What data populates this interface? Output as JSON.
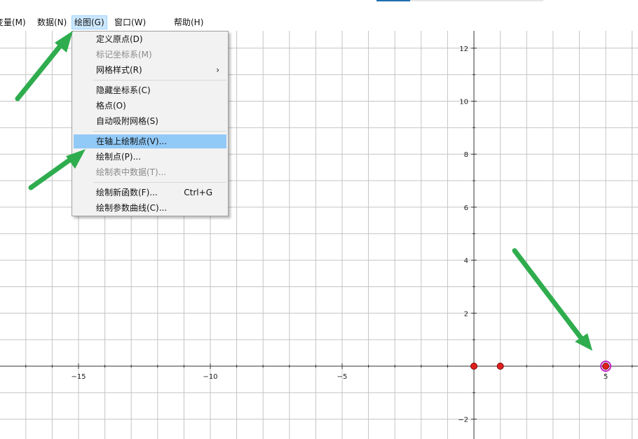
{
  "menubar": {
    "items": [
      {
        "label": "变量(M)"
      },
      {
        "label": "数据(N)"
      },
      {
        "label": "绘图(G)",
        "active": true
      },
      {
        "label": "窗口(W)"
      },
      {
        "label": "帮助(H)"
      }
    ]
  },
  "dropdown": {
    "items": [
      {
        "label": "定义原点(D)",
        "enabled": true
      },
      {
        "label": "标记坐标系(M)",
        "enabled": false
      },
      {
        "label": "网格样式(R)",
        "enabled": true,
        "submenu": true,
        "submenu_glyph": "›"
      },
      {
        "label": "隐藏坐标系(C)",
        "enabled": true
      },
      {
        "label": "格点(O)",
        "enabled": true
      },
      {
        "label": "自动吸附网格(S)",
        "enabled": true
      },
      {
        "label": "在轴上绘制点(V)...",
        "enabled": true,
        "highlighted": true
      },
      {
        "label": "绘制点(P)...",
        "enabled": true
      },
      {
        "label": "绘制表中数据(T)...",
        "enabled": false
      },
      {
        "label": "绘制新函数(F)...",
        "enabled": true,
        "shortcut": "Ctrl+G"
      },
      {
        "label": "绘制参数曲线(C)...",
        "enabled": true
      }
    ]
  },
  "graph": {
    "x_range": [
      -18,
      6
    ],
    "y_range": [
      -2.8,
      12.6
    ],
    "grid_step": 1,
    "x_tick_labels": [
      {
        "value": -15,
        "text": "−15"
      },
      {
        "value": -10,
        "text": "−10"
      },
      {
        "value": -5,
        "text": "−5"
      },
      {
        "value": 5,
        "text": "5"
      }
    ],
    "y_tick_labels": [
      {
        "value": 12,
        "text": "12"
      },
      {
        "value": 10,
        "text": "10"
      },
      {
        "value": 8,
        "text": "8"
      },
      {
        "value": 6,
        "text": "6"
      },
      {
        "value": 4,
        "text": "4"
      },
      {
        "value": 2,
        "text": "2"
      },
      {
        "value": -2,
        "text": "−2"
      }
    ],
    "points": [
      {
        "x": 0,
        "y": 0,
        "selected": false
      },
      {
        "x": 1,
        "y": 0,
        "selected": false
      },
      {
        "x": 5,
        "y": 0,
        "selected": true
      }
    ],
    "colors": {
      "grid": "#c4c4c4",
      "axis": "#333333",
      "point_fill": "#e0201e",
      "point_stroke": "#7a0000",
      "selection_ring": "#c020c0"
    }
  },
  "annotation": {
    "arrow_color": "#2fad4e"
  }
}
